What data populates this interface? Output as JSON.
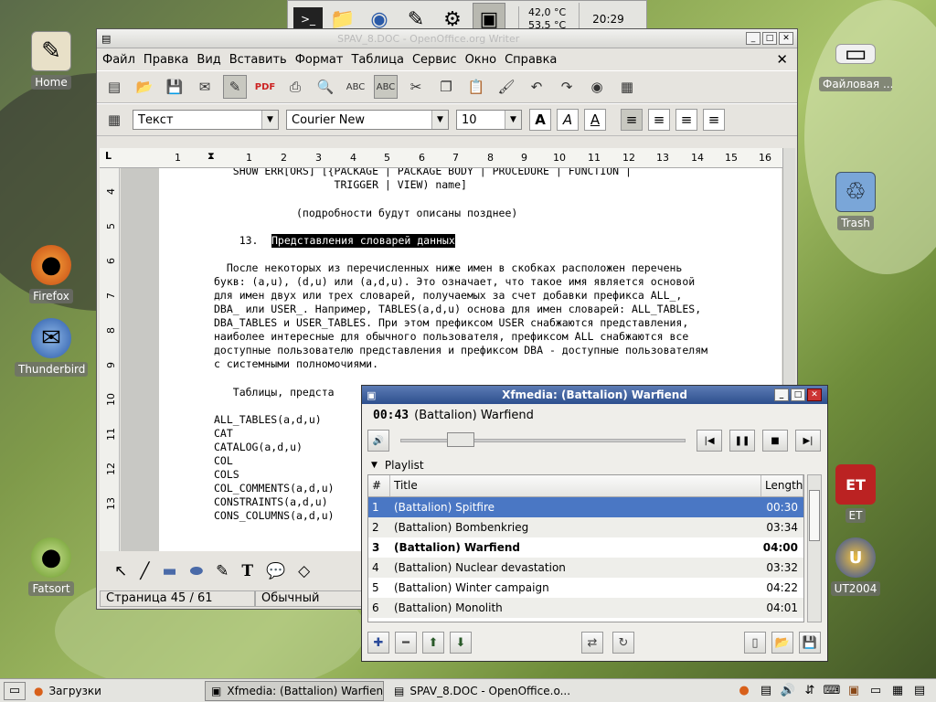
{
  "desktop": {
    "icons_left": [
      {
        "label": "Home",
        "icon": "home-icon"
      },
      {
        "label": "Firefox",
        "icon": "firefox-icon"
      },
      {
        "label": "Thunderbird",
        "icon": "thunderbird-icon"
      },
      {
        "label": "Fatsort",
        "icon": "fatsort-icon"
      }
    ],
    "icons_right": [
      {
        "label": "Файловая ...",
        "icon": "filesystem-icon"
      },
      {
        "label": "Trash",
        "icon": "trash-icon"
      },
      {
        "label": "ET",
        "icon": "et-icon"
      },
      {
        "label": "UT2004",
        "icon": "ut2004-icon"
      }
    ]
  },
  "top_panel": {
    "temp1": "42,0 °C",
    "temp2": "53,5 °C",
    "clock": "20:29"
  },
  "writer": {
    "title": "SPAV_8.DOC - OpenOffice.org Writer",
    "menu": [
      "Файл",
      "Правка",
      "Вид",
      "Вставить",
      "Формат",
      "Таблица",
      "Сервис",
      "Окно",
      "Справка"
    ],
    "style_value": "Текст",
    "font_value": "Courier New",
    "size_value": "10",
    "ruler_h": [
      "1",
      "1",
      "2",
      "3",
      "4",
      "5",
      "6",
      "7",
      "8",
      "9",
      "10",
      "11",
      "12",
      "13",
      "14",
      "15",
      "16"
    ],
    "ruler_v": [
      "4",
      "5",
      "6",
      "7",
      "8",
      "9",
      "10",
      "11",
      "12",
      "13"
    ],
    "doc_lines": [
      "   SHOW ERR[ORS] [{PACKAGE | PACKAGE BODY | PROCEDURE | FUNCTION |",
      "                   TRIGGER | VIEW) name]",
      "",
      "             (подробности будут описаны позднее)",
      "",
      "    13. ",
      "",
      "  После некоторых из перечисленных ниже имен в скобках расположен перечень",
      "букв: (a,u), (d,u) или (a,d,u). Это означает, что такое имя является основой",
      "для имен двух или трех словарей, получаемых за счет добавки префикса ALL_,",
      "DBA_ или USER_. Например, TABLES(a,d,u) основа для имен словарей: ALL_TABLES,",
      "DBA_TABLES и USER_TABLES. При этом префиксом USER снабжаются представления,",
      "наиболее интересные для обычного пользователя, префиксом ALL снабжаются все",
      "доступные пользователю представления и префиксом DBA - доступные пользователям",
      "с системными полномочиями.",
      "",
      "   Таблицы, предста",
      "",
      "ALL_TABLES(a,d,u)",
      "CAT",
      "CATALOG(a,d,u)",
      "COL",
      "COLS",
      "COL_COMMENTS(a,d,u)",
      "CONSTRAINTS(a,d,u)",
      "CONS_COLUMNS(a,d,u)"
    ],
    "heading_highlight": "Представления словарей данных",
    "status_page": "Страница  45 / 61",
    "status_style": "Обычный"
  },
  "xfmedia": {
    "title": "Xfmedia: (Battalion) Warfiend",
    "time": "00:43",
    "now_playing": "(Battalion) Warfiend",
    "seek_fraction": 0.18,
    "playlist_label": "Playlist",
    "col_num": "#",
    "col_title": "Title",
    "col_length": "Length",
    "tracks": [
      {
        "n": "1",
        "title": "(Battalion) Spitfire",
        "len": "00:30"
      },
      {
        "n": "2",
        "title": "(Battalion) Bombenkrieg",
        "len": "03:34"
      },
      {
        "n": "3",
        "title": "(Battalion) Warfiend",
        "len": "04:00"
      },
      {
        "n": "4",
        "title": "(Battalion) Nuclear devastation",
        "len": "03:32"
      },
      {
        "n": "5",
        "title": "(Battalion) Winter campaign",
        "len": "04:22"
      },
      {
        "n": "6",
        "title": "(Battalion) Monolith",
        "len": "04:01"
      }
    ]
  },
  "taskbar": {
    "items": [
      {
        "label": "Загрузки",
        "active": false
      },
      {
        "label": "Xfmedia: (Battalion) Warfiend",
        "active": true
      },
      {
        "label": "SPAV_8.DOC - OpenOffice.o...",
        "active": false
      }
    ]
  }
}
